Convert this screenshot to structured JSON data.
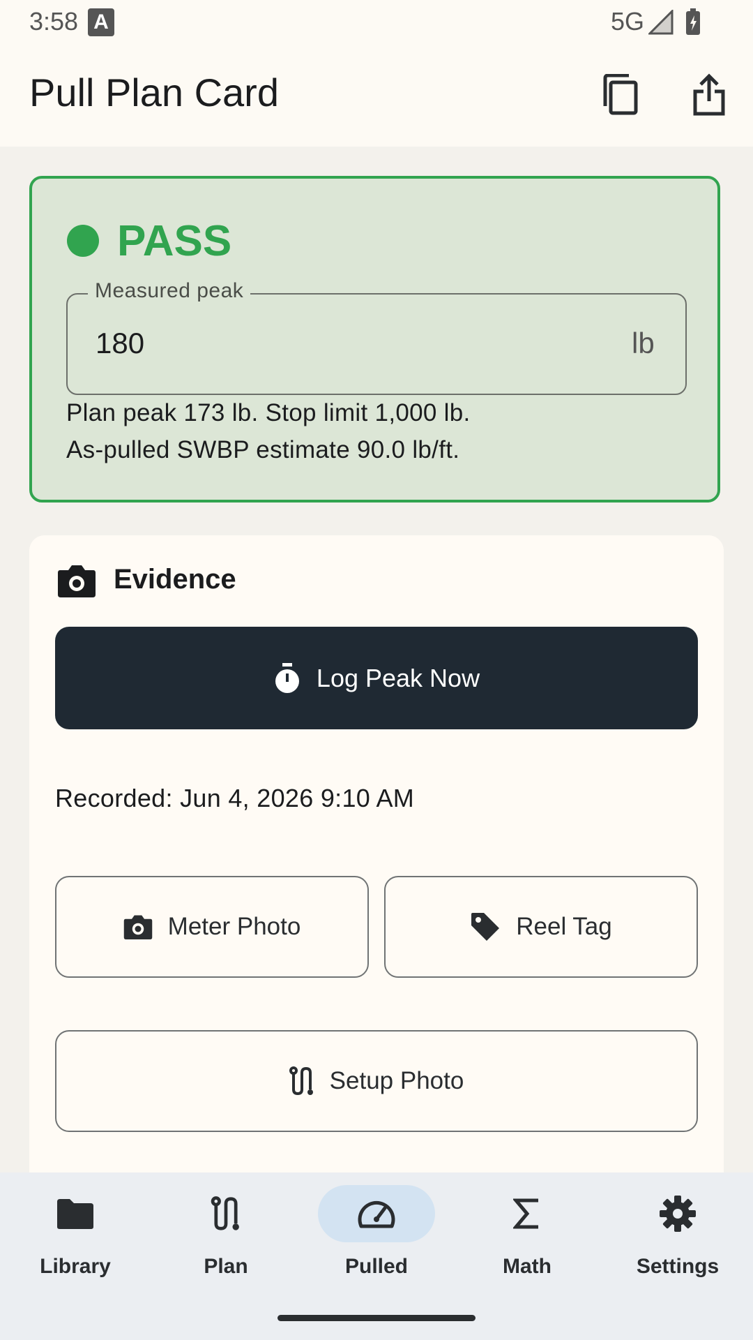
{
  "status_bar": {
    "time": "3:58",
    "network": "5G",
    "notification_icon": "A"
  },
  "app_bar": {
    "title": "Pull Plan Card",
    "actions": [
      "copy-icon",
      "share-icon"
    ]
  },
  "result": {
    "status": "PASS",
    "status_color": "#31a44f",
    "measured_peak_label": "Measured peak",
    "measured_peak_value": "180",
    "measured_peak_unit": "lb",
    "line1": "Plan peak 173 lb. Stop limit 1,000 lb.",
    "line2": "As-pulled SWBP estimate 90.0 lb/ft."
  },
  "evidence": {
    "title": "Evidence",
    "log_button": "Log Peak Now",
    "recorded": "Recorded: Jun 4, 2026 9:10 AM",
    "meter_photo": "Meter Photo",
    "reel_tag": "Reel Tag",
    "setup_photo": "Setup Photo"
  },
  "nav": {
    "items": [
      {
        "label": "Library",
        "icon": "folder-icon"
      },
      {
        "label": "Plan",
        "icon": "route-icon"
      },
      {
        "label": "Pulled",
        "icon": "speedometer-icon",
        "active": true
      },
      {
        "label": "Math",
        "icon": "sigma-icon"
      },
      {
        "label": "Settings",
        "icon": "gear-icon"
      }
    ]
  },
  "colors": {
    "primary_button": "#1f2933",
    "pass_bg": "#dce6d6",
    "active_nav": "#d3e3f2"
  }
}
